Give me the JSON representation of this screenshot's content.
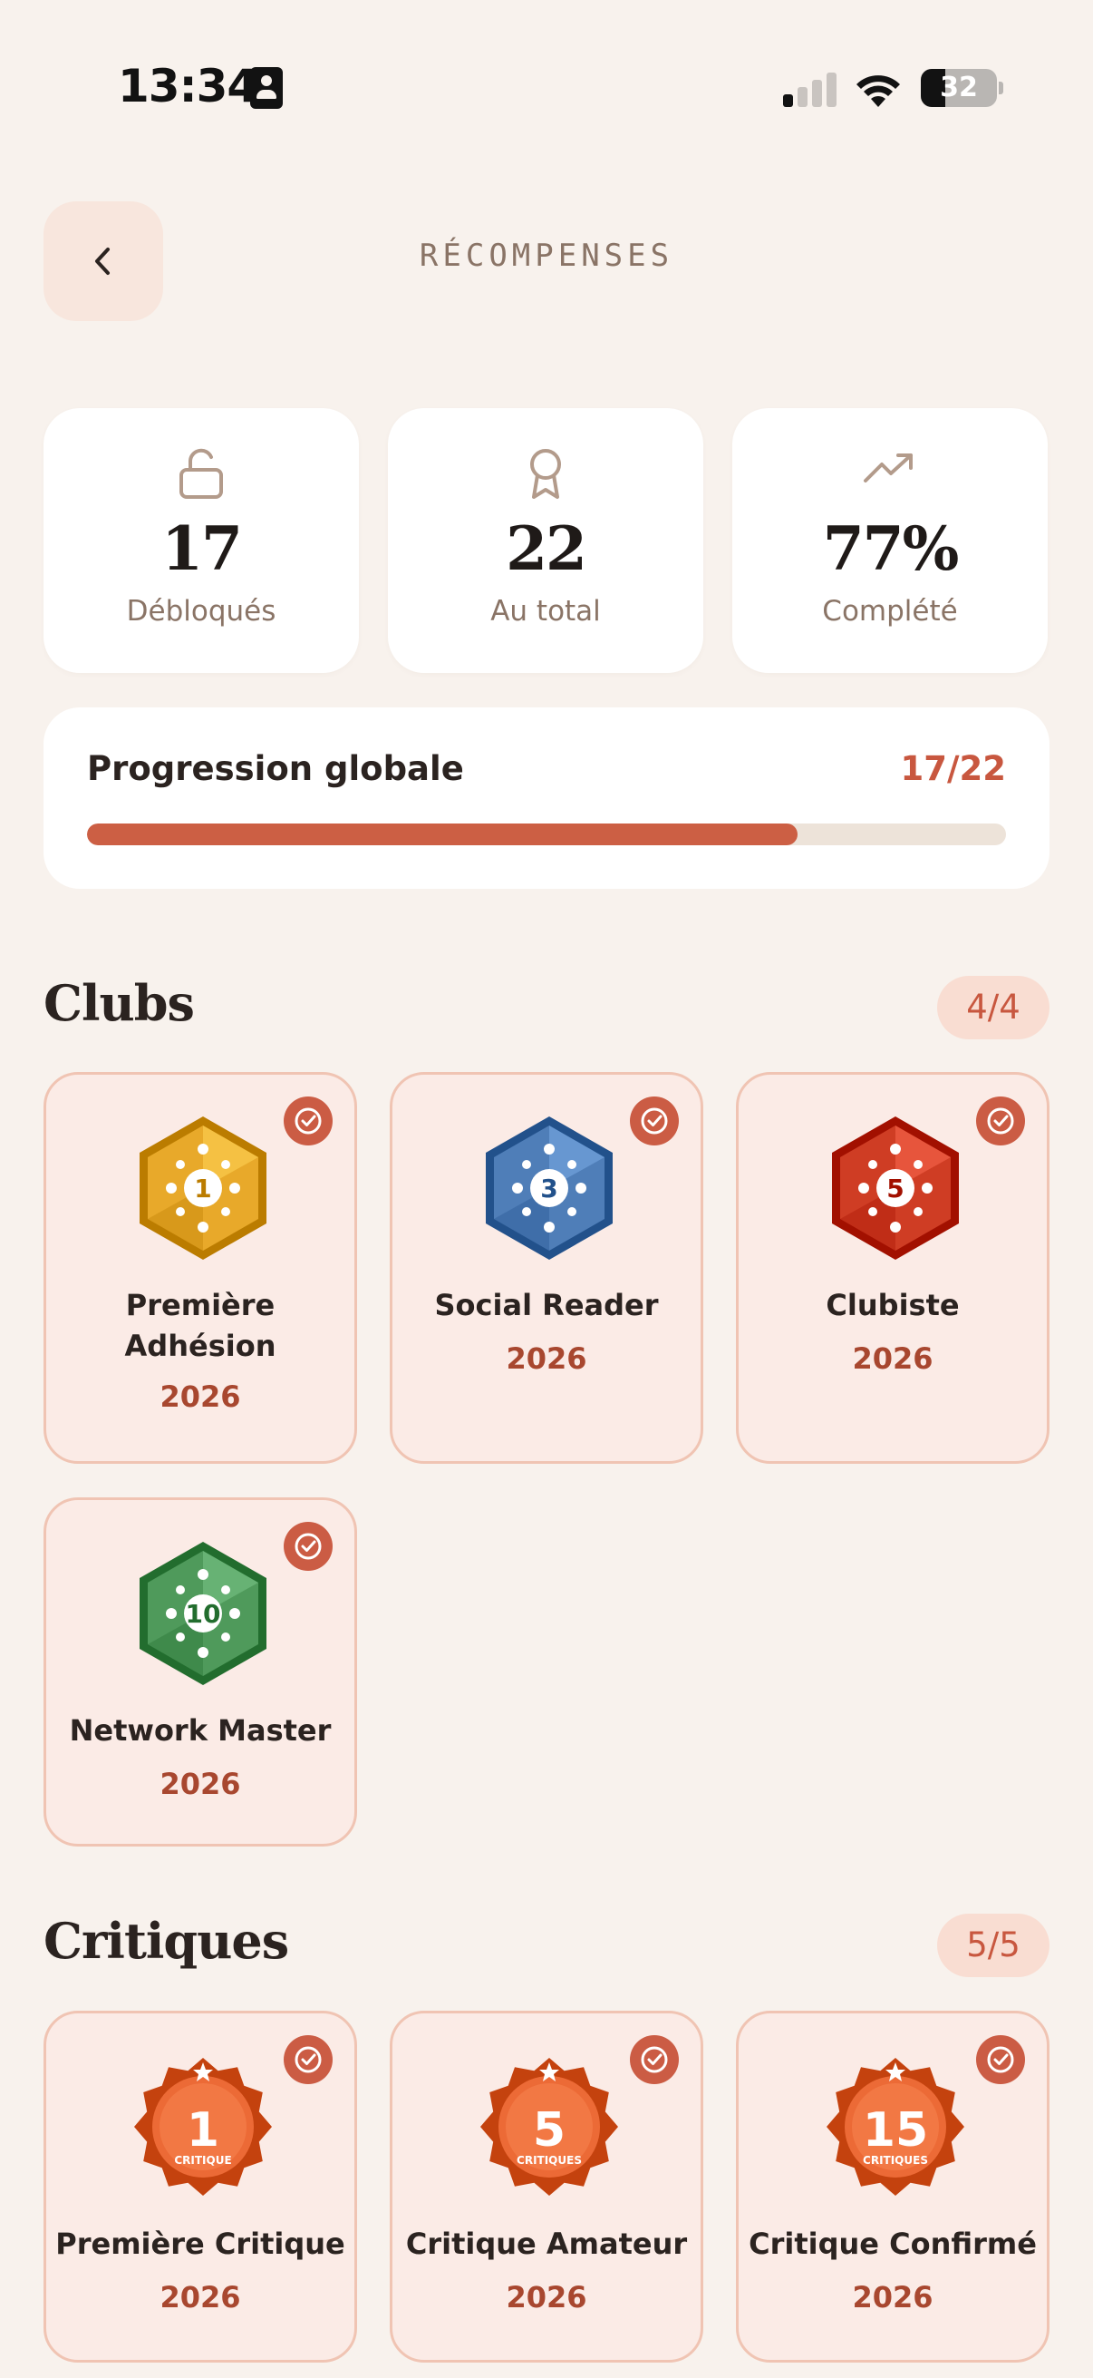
{
  "status_bar": {
    "time": "13:34",
    "battery": "32",
    "battery_level": 0.32
  },
  "header": {
    "title": "RÉCOMPENSES",
    "back_icon": "chevron-left-icon"
  },
  "stats": [
    {
      "icon": "unlock-icon",
      "value": "17",
      "label": "Débloqués"
    },
    {
      "icon": "award-ribbon-icon",
      "value": "22",
      "label": "Au total"
    },
    {
      "icon": "trending-up-icon",
      "value": "77%",
      "label": "Complété"
    }
  ],
  "progress": {
    "title": "Progression globale",
    "count": "17/22",
    "ratio": 0.773
  },
  "sections": [
    {
      "title": "Clubs",
      "count": "4/4",
      "badges": [
        {
          "name": "Première Adhésion",
          "year": "2026",
          "badge_number": "1",
          "badge_color": "#e8a92a",
          "badge_type": "hexagon"
        },
        {
          "name": "Social Reader",
          "year": "2026",
          "badge_number": "3",
          "badge_color": "#4f7eb8",
          "badge_type": "hexagon"
        },
        {
          "name": "Clubiste",
          "year": "2026",
          "badge_number": "5",
          "badge_color": "#cf3d24",
          "badge_type": "hexagon"
        },
        {
          "name": "Network Master",
          "year": "2026",
          "badge_number": "10",
          "badge_color": "#4f9a5b",
          "badge_type": "hexagon"
        }
      ]
    },
    {
      "title": "Critiques",
      "count": "5/5",
      "badges": [
        {
          "name": "Première Critique",
          "year": "2026",
          "badge_number": "1",
          "badge_sub": "CRITIQUE",
          "badge_color": "#ec6a36",
          "badge_type": "seal"
        },
        {
          "name": "Critique Amateur",
          "year": "2026",
          "badge_number": "5",
          "badge_sub": "CRITIQUES",
          "badge_color": "#ec6a36",
          "badge_type": "seal"
        },
        {
          "name": "Critique Confirmé",
          "year": "2026",
          "badge_number": "15",
          "badge_sub": "CRITIQUES",
          "badge_color": "#ec6a36",
          "badge_type": "seal"
        }
      ]
    }
  ],
  "colors": {
    "accent": "#cc5f44",
    "background": "#f8f2ed",
    "card_tint": "#fbebe6"
  }
}
